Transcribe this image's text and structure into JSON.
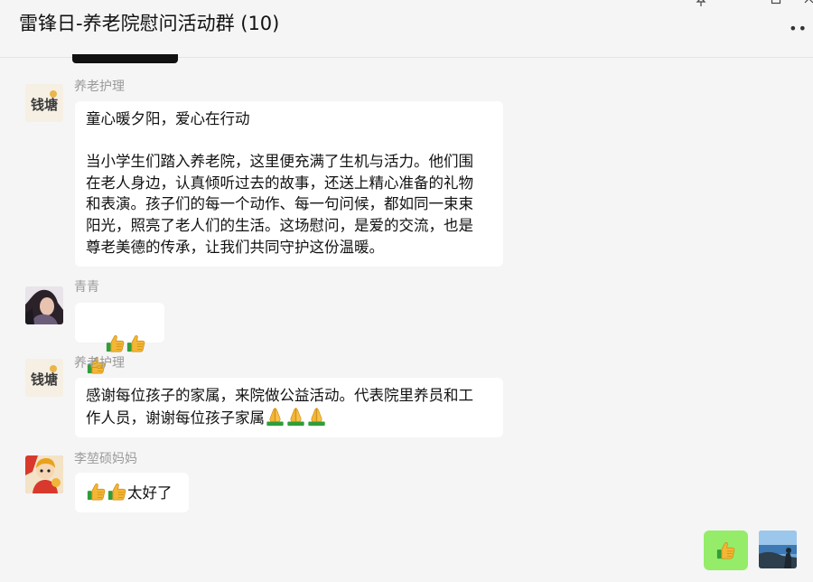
{
  "header": {
    "title": "雷锋日-养老院慰问活动群 (10)"
  },
  "messages": [
    {
      "sender": "养老护理",
      "text_lines": [
        "童心暖夕阳，爱心在行动",
        "",
        "当小学生们踏入养老院，这里便充满了生机与活力。他们围",
        "在老人身边，认真倾听过去的故事，还送上精心准备的礼物",
        "和表演。孩子们的每一个动作、每一句问候，都如同一束束",
        "阳光，照亮了老人们的生活。这场慰问，是爱的交流，也是",
        "尊老美德的传承，让我们共同守护这份温暖。"
      ]
    },
    {
      "sender": "青青",
      "emojis": [
        "thumbs-up",
        "thumbs-up",
        "thumbs-up"
      ]
    },
    {
      "sender": "养老护理",
      "line1": "感谢每位孩子的家属，来院做公益活动。代表院里养员和工",
      "line2": "作人员，谢谢每位孩子家属",
      "emojis": [
        "folded-hands",
        "folded-hands",
        "folded-hands"
      ]
    },
    {
      "sender": "李堃硕妈妈",
      "text": "太好了",
      "emojis": [
        "thumbs-up",
        "thumbs-up"
      ]
    }
  ],
  "self_message": {
    "emoji": "thumbs-up"
  },
  "avatar_text": {
    "yanglao": "钱塘"
  },
  "colors": {
    "background": "#f5f5f5",
    "bubble_other": "#ffffff",
    "bubble_self": "#95ec69",
    "sender_name": "#9a9a9a"
  }
}
